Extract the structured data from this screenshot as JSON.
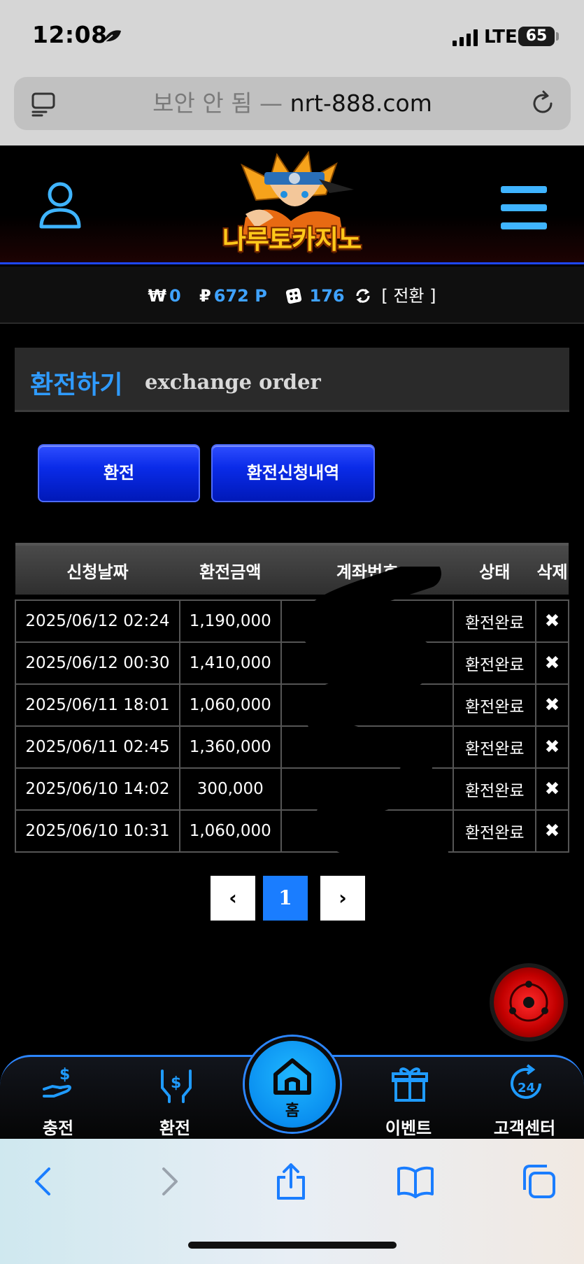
{
  "status_bar": {
    "time": "12:08",
    "network": "LTE",
    "battery": "65"
  },
  "browser": {
    "insecure_label": "보안 안 됨 —",
    "domain": "nrt-888.com"
  },
  "site": {
    "logo_text": "나루토카지노",
    "accent": "#2f9bff",
    "brand_blue": "#0a2be8"
  },
  "balance": {
    "won_symbol": "₩",
    "won_value": "0",
    "point_symbol": "₽",
    "point_value": "672 P",
    "chip_value": "176",
    "convert_label": "[ 전환 ]"
  },
  "section": {
    "title_ko": "환전하기",
    "title_en": "exchange order"
  },
  "actions": {
    "exchange_label": "환전",
    "history_label": "환전신청내역"
  },
  "table": {
    "headers": [
      "신청날짜",
      "환전금액",
      "계좌번호",
      "상태",
      "삭제"
    ],
    "rows": [
      {
        "date": "2025/06/12 02:24",
        "amount": "1,190,000",
        "status": "환전완료"
      },
      {
        "date": "2025/06/12 00:30",
        "amount": "1,410,000",
        "status": "환전완료"
      },
      {
        "date": "2025/06/11 18:01",
        "amount": "1,060,000",
        "status": "환전완료"
      },
      {
        "date": "2025/06/11 02:45",
        "amount": "1,360,000",
        "status": "환전완료"
      },
      {
        "date": "2025/06/10 14:02",
        "amount": "300,000",
        "status": "환전완료"
      },
      {
        "date": "2025/06/10 10:31",
        "amount": "1,060,000",
        "status": "환전완료"
      }
    ],
    "delete_glyph": "✖"
  },
  "pagination": {
    "prev": "‹",
    "current": "1",
    "next": "›"
  },
  "bottom_nav": {
    "charge": "충전",
    "exchange": "환전",
    "home": "홈",
    "event": "이벤트",
    "support": "고객센터"
  }
}
